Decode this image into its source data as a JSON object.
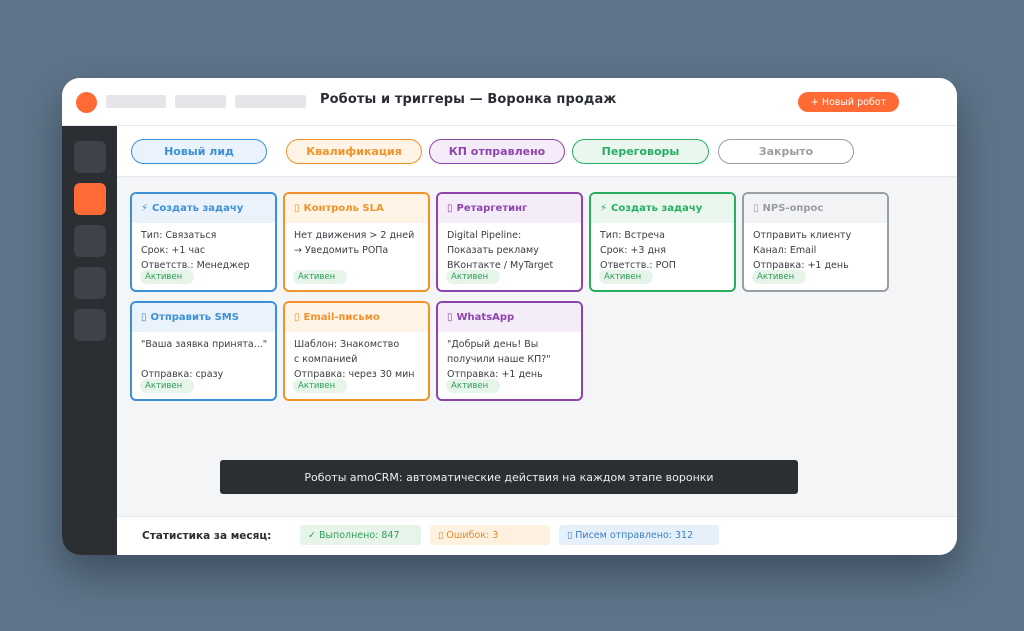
{
  "window": {
    "title": "Роботы и триггеры — Воронка продаж",
    "new_robot_label": "+ Новый робот"
  },
  "stages": [
    {
      "label": "Новый лид",
      "color": "#3d8fd6",
      "bg": "#eaf3fc"
    },
    {
      "label": "Квалификация",
      "color": "#f0932b",
      "bg": "#fff4e6"
    },
    {
      "label": "КП отправлено",
      "color": "#8e44ad",
      "bg": "#f5ecf9"
    },
    {
      "label": "Переговоры",
      "color": "#27ae60",
      "bg": "#eaf7ef"
    },
    {
      "label": "Закрыто",
      "color": "#9a9da3",
      "bg": "#ffffff"
    }
  ],
  "cards": [
    {
      "icon": "lightning-icon",
      "glyph": "⚡",
      "title": "Создать задачу",
      "lines": [
        "Тип: Связаться",
        "Срок: +1 час",
        "Ответств.: Менеджер"
      ],
      "status": "Активен",
      "color": "#3d8fd6",
      "head_bg": "#eaf3fc"
    },
    {
      "icon": "clock-icon",
      "glyph": "▯",
      "title": "Контроль SLA",
      "lines": [
        "Нет движения > 2 дней",
        "→ Уведомить РОПа",
        ""
      ],
      "status": "Активен",
      "color": "#f0932b",
      "head_bg": "#fff4e6"
    },
    {
      "icon": "target-icon",
      "glyph": "▯",
      "title": "Ретаргетинг",
      "lines": [
        "Digital Pipeline:",
        "Показать рекламу",
        "ВКонтакте / MyTarget"
      ],
      "status": "Активен",
      "color": "#8e44ad",
      "head_bg": "#f5ecf9"
    },
    {
      "icon": "lightning-icon",
      "glyph": "⚡",
      "title": "Создать задачу",
      "lines": [
        "Тип: Встреча",
        "Срок: +3 дня",
        "Ответств.: РОП"
      ],
      "status": "Активен",
      "color": "#27ae60",
      "head_bg": "#eaf7ef"
    },
    {
      "icon": "survey-icon",
      "glyph": "▯",
      "title": "NPS-опрос",
      "lines": [
        "Отправить клиенту",
        "Канал: Email",
        "Отправка: +1 день"
      ],
      "status": "Активен",
      "color": "#9a9da3",
      "head_bg": "#f2f3f5"
    },
    {
      "icon": "sms-icon",
      "glyph": "▯",
      "title": "Отправить SMS",
      "lines": [
        "\"Ваша заявка принята...\"",
        "",
        "Отправка: сразу"
      ],
      "status": "Активен",
      "color": "#3d8fd6",
      "head_bg": "#eaf3fc"
    },
    {
      "icon": "email-icon",
      "glyph": "▯",
      "title": "Email-письмо",
      "lines": [
        "Шаблон: Знакомство",
        "с компанией",
        "Отправка: через 30 мин"
      ],
      "status": "Активен",
      "color": "#f0932b",
      "head_bg": "#fff4e6"
    },
    {
      "icon": "whatsapp-icon",
      "glyph": "▯",
      "title": "WhatsApp",
      "lines": [
        "\"Добрый день! Вы",
        "получили наше КП?\"",
        "Отправка: +1 день"
      ],
      "status": "Активен",
      "color": "#8e44ad",
      "head_bg": "#f5ecf9"
    }
  ],
  "caption": "Роботы amoCRM: автоматические действия на каждом этапе воронки",
  "stats": {
    "label": "Статистика за месяц:",
    "items": [
      {
        "text": "✓ Выполнено: 847",
        "color": "#2e9e57",
        "bg": "#e6f4ea"
      },
      {
        "text": "▯ Ошибок: 3",
        "color": "#e08a2b",
        "bg": "#fff1e0"
      },
      {
        "text": "▯ Писем отправлено: 312",
        "color": "#3d7fc4",
        "bg": "#e6f0fb"
      }
    ]
  }
}
